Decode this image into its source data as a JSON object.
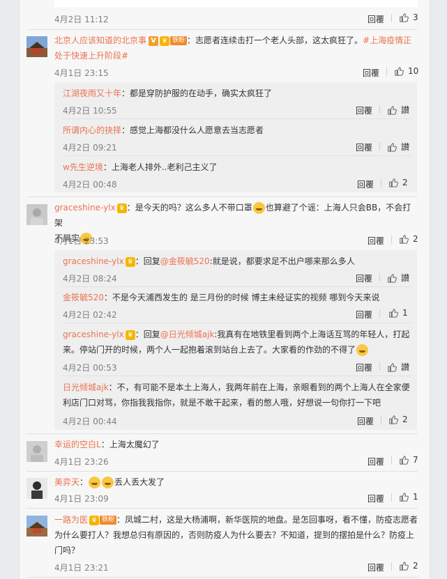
{
  "comments": [
    {
      "time": "4月2日 11:12",
      "reply": "回覆",
      "likes": "3"
    },
    {
      "user": "北京人应该知道的北京事",
      "badge": "铁粉",
      "text": "：志愿者连续击打一个老人头部，这太疯狂了。",
      "hashtag": "#上海疫情正处于快速上升阶段#",
      "time": "4月1日 23:15",
      "reply": "回覆",
      "likes": "10",
      "subs": [
        {
          "user": "江湖夜雨又十年",
          "text": "：都是穿防护服的在动手，确实太疯狂了",
          "time": "4月2日 10:55",
          "reply": "回覆",
          "likes": "讃"
        },
        {
          "user": "所谓内心的抉择",
          "text": "：感觉上海都没什么人愿意去当志愿者",
          "time": "4月2日 09:21",
          "reply": "回覆",
          "likes": "讃"
        },
        {
          "user": "w先生逆境",
          "text": "：上海老人排外..老利己主义了",
          "time": "4月2日 00:48",
          "reply": "回覆",
          "likes": "2"
        }
      ]
    },
    {
      "user": "graceshine-ylx",
      "text1": "：是今天的吗？这么多人不带口罩",
      "text2": "也算避了个谣：上海人只会BB，不会打架",
      "text3": "不屑实",
      "time": "4月1日 23:53",
      "reply": "回覆",
      "likes": "2",
      "subs": [
        {
          "user": "graceshine-ylx",
          "pre": "：回复",
          "mention": "@金筱毓520",
          "text": ":就是说，都要求足不出户哪来那么多人",
          "time": "4月2日 08:24",
          "reply": "回覆",
          "likes": "讃"
        },
        {
          "user": "金筱毓520",
          "text": "：不是今天浦西发生的 是三月份的时候 博主未经证实的视频 哪到今天来说",
          "time": "4月2日 02:42",
          "reply": "回覆",
          "likes": "1"
        },
        {
          "user": "graceshine-ylx",
          "pre": "：回复",
          "mention": "@日光倾城ajk",
          "text": ":我真有在地铁里看到两个上海话互骂的年轻人，打起",
          "text2": "来。停站门开的时候，两个人一起抱着滚到站台上去了。大家看的作劲的不得了",
          "time": "4月2日 00:53",
          "reply": "回覆",
          "likes": "讃"
        },
        {
          "user": "日光倾城ajk",
          "text": "：不，有可能不是本土上海人，我两年前在上海，亲眼看到的两个上海人在全家便",
          "text2": "利店门口对骂，你指我我指你，就是不敢干起来，看的憋人哦，好想说一句你打一下吧",
          "time": "4月2日 00:44",
          "reply": "回覆",
          "likes": "2"
        }
      ]
    },
    {
      "user": "幸运的空白L",
      "text": "：上海太魔幻了",
      "time": "4月1日 23:26",
      "reply": "回覆",
      "likes": "7"
    },
    {
      "user": "美弈天",
      "text": "丢人丢大发了",
      "time": "4月1日 23:09",
      "reply": "回覆",
      "likes": "1"
    },
    {
      "user": "一路为医",
      "badge": "铁粉",
      "text": "：凤城二村，这是大杨浦啊，新华医院的地盘。是怎回事呀，看不懂，防疫志愿者",
      "text2": "为什么要打人？我想总归有原因的，否则防疫人为什么要去？不知道，提到的摆拍是什么？防疫上",
      "text3": "门吗？",
      "time": "4月1日 23:21",
      "reply": "回覆",
      "likes": "2"
    }
  ],
  "colors": {
    "username": "#eb7350",
    "panel": "#f7f7f7",
    "subpanel": "#efefef"
  }
}
